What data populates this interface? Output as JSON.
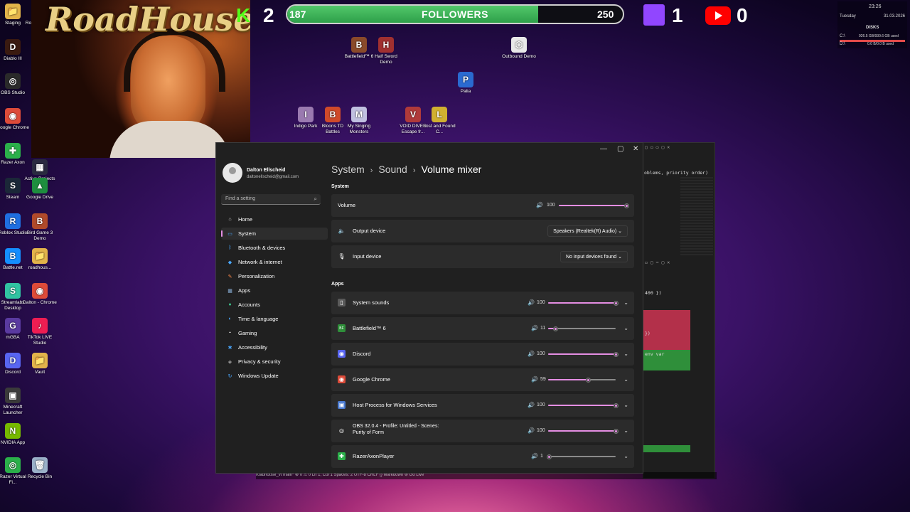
{
  "desktop": {
    "icons_left": [
      {
        "label": "Staging",
        "color": "#e2b34a",
        "glyph": "📁"
      },
      {
        "label": "Roblox Player",
        "color": "#1f6fe0",
        "glyph": "R"
      },
      {
        "label": "Diablo III",
        "color": "#3a1a10",
        "glyph": "D"
      },
      {
        "label": "OBS Studio",
        "color": "#2a2a2a",
        "glyph": "◎"
      },
      {
        "label": "Google Chrome",
        "color": "#dd4b39",
        "glyph": "◉"
      },
      {
        "label": "Razer Axon",
        "color": "#2bb04a",
        "glyph": "✚"
      },
      {
        "label": "Active Projects",
        "color": "#2a2a40",
        "glyph": "▦"
      },
      {
        "label": "Steam",
        "color": "#1b2838",
        "glyph": "S"
      },
      {
        "label": "Google Drive",
        "color": "#1e8e3e",
        "glyph": "▲"
      },
      {
        "label": "Roblox Studio",
        "color": "#1f6fe0",
        "glyph": "R"
      },
      {
        "label": "Bird Game 3 Demo",
        "color": "#b04a2a",
        "glyph": "B"
      },
      {
        "label": "Battle.net",
        "color": "#148eff",
        "glyph": "B"
      },
      {
        "label": "roadhous...",
        "color": "#e2b34a",
        "glyph": "📁"
      },
      {
        "label": "Streamlabs Desktop",
        "color": "#31c3a2",
        "glyph": "S"
      },
      {
        "label": "Dalton - Chrome",
        "color": "#dd4b39",
        "glyph": "◉"
      },
      {
        "label": "mGBA",
        "color": "#5a3aa0",
        "glyph": "G"
      },
      {
        "label": "TikTok LIVE Studio",
        "color": "#ee1d52",
        "glyph": "♪"
      },
      {
        "label": "Discord",
        "color": "#5865f2",
        "glyph": "D"
      },
      {
        "label": "Vault",
        "color": "#e2b34a",
        "glyph": "📁"
      },
      {
        "label": "Minecraft Launcher",
        "color": "#3a3a3a",
        "glyph": "▣"
      },
      {
        "label": "NVIDIA App",
        "color": "#76b900",
        "glyph": "N"
      },
      {
        "label": "Razer Virtual Fi...",
        "color": "#2bb04a",
        "glyph": "◎"
      },
      {
        "label": "Recycle Bin",
        "color": "#9ab0c8",
        "glyph": "🗑"
      }
    ],
    "icons_center": [
      {
        "label": "Battlefield™ 6",
        "color": "#8a4a2a",
        "glyph": "B"
      },
      {
        "label": "Half Sword Demo",
        "color": "#a03030",
        "glyph": "H"
      },
      {
        "label": "Outbound Demo",
        "color": "#e8e8e8",
        "glyph": "⬡"
      },
      {
        "label": "Palia",
        "color": "#2a6ad0",
        "glyph": "P"
      },
      {
        "label": "Indigo Park",
        "color": "#9a7ab0",
        "glyph": "I"
      },
      {
        "label": "Bloons TD Battles",
        "color": "#d04a2a",
        "glyph": "B"
      },
      {
        "label": "My Singing Monsters",
        "color": "#c0c0e0",
        "glyph": "M"
      },
      {
        "label": "VOID DIVER Escape fr...",
        "color": "#b03a3a",
        "glyph": "V"
      },
      {
        "label": "Lost and Found C...",
        "color": "#d0b030",
        "glyph": "L"
      }
    ]
  },
  "overlay": {
    "brand_text": "RoadHouse",
    "kick_icon": "K",
    "kick_count": "2",
    "followers_current": "187",
    "followers_label": "FOLLOWERS",
    "followers_target": "250",
    "followers_progress": 0.748,
    "twitch_count": "1",
    "youtube_count": "0"
  },
  "system_widget": {
    "time": "23:26",
    "day": "Tuesday",
    "date": "31.03.2026",
    "disks_title": "DISKS",
    "disk1_label": "C:\\",
    "disk1_value": "926.5 GB/930.6 GB used",
    "disk2_label": "D:\\",
    "disk2_value": "0.0 B/0.0 B used"
  },
  "settings": {
    "user": {
      "name": "Dalton Ellscheid",
      "email": "daltonellscheid@gmail.com"
    },
    "search_placeholder": "Find a setting",
    "nav": [
      {
        "label": "Home",
        "icon": "home-icon",
        "glyph": "⌂",
        "color": "#cfcfcf"
      },
      {
        "label": "System",
        "icon": "system-icon",
        "glyph": "▭",
        "color": "#4aa8ff"
      },
      {
        "label": "Bluetooth & devices",
        "icon": "bluetooth-icon",
        "glyph": "ᛒ",
        "color": "#4aa8ff"
      },
      {
        "label": "Network & internet",
        "icon": "wifi-icon",
        "glyph": "◆",
        "color": "#4aa8ff"
      },
      {
        "label": "Personalization",
        "icon": "brush-icon",
        "glyph": "✎",
        "color": "#ff8a4a"
      },
      {
        "label": "Apps",
        "icon": "apps-icon",
        "glyph": "▦",
        "color": "#8ab0d8"
      },
      {
        "label": "Accounts",
        "icon": "accounts-icon",
        "glyph": "●",
        "color": "#3ac08a"
      },
      {
        "label": "Time & language",
        "icon": "globe-icon",
        "glyph": "◐",
        "color": "#4aa8ff"
      },
      {
        "label": "Gaming",
        "icon": "gaming-icon",
        "glyph": "◓",
        "color": "#aaaaaa"
      },
      {
        "label": "Accessibility",
        "icon": "accessibility-icon",
        "glyph": "✱",
        "color": "#4aa8ff"
      },
      {
        "label": "Privacy & security",
        "icon": "shield-icon",
        "glyph": "◈",
        "color": "#aaaaaa"
      },
      {
        "label": "Windows Update",
        "icon": "update-icon",
        "glyph": "↻",
        "color": "#4aa8ff"
      }
    ],
    "active_nav_index": 1,
    "breadcrumb": {
      "part1": "System",
      "part2": "Sound",
      "current": "Volume mixer"
    },
    "section_system": "System",
    "volume": {
      "label": "Volume",
      "value": "100",
      "level": 100
    },
    "output_device": {
      "label": "Output device",
      "value": "Speakers (Realtek(R) Audio)"
    },
    "input_device": {
      "label": "Input device",
      "value": "No input devices found"
    },
    "section_apps": "Apps",
    "apps": [
      {
        "name": "System sounds",
        "value": "100",
        "level": 100,
        "icon": "speaker-box-icon",
        "glyph": "▯",
        "color": "#5a5a5a"
      },
      {
        "name": "Battlefield™ 6",
        "value": "11",
        "level": 11,
        "icon": "battlefield-icon",
        "glyph": "BF",
        "color": "#2f8f3a"
      },
      {
        "name": "Discord",
        "value": "100",
        "level": 100,
        "icon": "discord-icon",
        "glyph": "◉",
        "color": "#5865f2"
      },
      {
        "name": "Google Chrome",
        "value": "59",
        "level": 59,
        "icon": "chrome-icon",
        "glyph": "◉",
        "color": "#dd4b39"
      },
      {
        "name": "Host Process for Windows Services",
        "value": "100",
        "level": 100,
        "icon": "window-icon",
        "glyph": "▣",
        "color": "#4a7ad0"
      },
      {
        "name": "OBS 32.0.4 - Profile: Untitled - Scenes: Purity of Form",
        "value": "100",
        "level": 100,
        "icon": "obs-icon",
        "glyph": "◎",
        "color": "#2a2a2a"
      },
      {
        "name": "RazerAxonPlayer",
        "value": "1",
        "level": 1,
        "icon": "razer-icon",
        "glyph": "✚",
        "color": "#2bb04a"
      }
    ]
  },
  "code_window": {
    "line1": "oblems, priority order)",
    "line2": "400 })",
    "line3": "})",
    "line4": "env var"
  },
  "statusbar": {
    "text": "roadhouse_vt   main*   ⊗ 0 ⚠ 0   Ln 1, Col 1   Spaces: 2   UTF-8   CRLF   {} Markdown   ⊚ Go Live"
  },
  "colors": {
    "accent": "#e58ee3",
    "window_bg": "#202020",
    "card_bg": "#2b2b2b"
  }
}
